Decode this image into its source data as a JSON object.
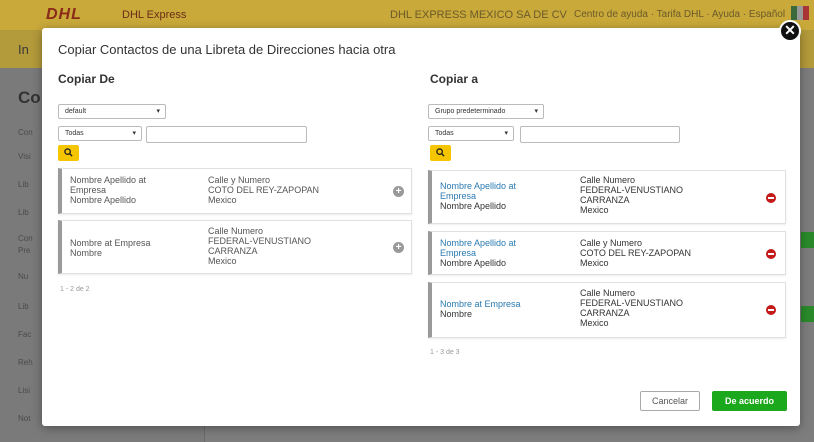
{
  "background": {
    "logo": "DHL",
    "brand": "DHL Express",
    "company": "DHL EXPRESS MEXICO SA DE CV",
    "header_links": "Centro de ayuda · Tarifa DHL · Ayuda · Español",
    "nav_partial": "In",
    "sidebar_title": "Co",
    "sidebar_items": [
      "Con",
      "Visi",
      "Lib",
      "Lib",
      "Con",
      "Pre",
      "Nu",
      "Lib",
      "Fac",
      "Reh",
      "Lisi",
      "Not"
    ]
  },
  "modal": {
    "title": "Copiar Contactos de una Libreta de Direcciones hacia otra",
    "close_symbol": "✕",
    "left": {
      "title": "Copiar De",
      "book_select": "default",
      "filter_select": "Todas",
      "search_value": "",
      "pager": "1 - 2 de 2",
      "cards": [
        {
          "line1": "Nombre Apellido at",
          "line2": "Empresa",
          "line3": "Nombre Apellido",
          "addr1": "Calle y Numero",
          "addr2": "COTO DEL REY-ZAPOPAN",
          "addr3": "Mexico",
          "addr4": ""
        },
        {
          "line1": "Nombre at Empresa",
          "line2": "Nombre",
          "line3": "",
          "addr1": "Calle Numero",
          "addr2": "FEDERAL-VENUSTIANO",
          "addr3": "CARRANZA",
          "addr4": "Mexico"
        }
      ]
    },
    "right": {
      "title": "Copiar a",
      "book_select": "Grupo predeterminado",
      "filter_select": "Todas",
      "search_value": "",
      "pager": "1 - 3 de 3",
      "cards": [
        {
          "line1": "Nombre Apellido at",
          "line2": "Empresa",
          "line3": "Nombre Apellido",
          "addr1": "Calle Numero",
          "addr2": "FEDERAL-VENUSTIANO",
          "addr3": "CARRANZA",
          "addr4": "Mexico"
        },
        {
          "line1": "Nombre Apellido at",
          "line2": "Empresa",
          "line3": "Nombre Apellido",
          "addr1": "Calle y Numero",
          "addr2": "COTO DEL REY-ZAPOPAN",
          "addr3": "Mexico",
          "addr4": ""
        },
        {
          "line1": "Nombre at Empresa",
          "line2": "Nombre",
          "line3": "",
          "addr1": "Calle Numero",
          "addr2": "FEDERAL-VENUSTIANO",
          "addr3": "CARRANZA",
          "addr4": "Mexico"
        }
      ]
    },
    "cancel_label": "Cancelar",
    "ok_label": "De acuerdo"
  },
  "colors": {
    "accent_yellow": "#f5c500",
    "ok_green": "#1ca81c",
    "remove_red": "#c41a1a",
    "link_blue": "#2a7ab0"
  }
}
